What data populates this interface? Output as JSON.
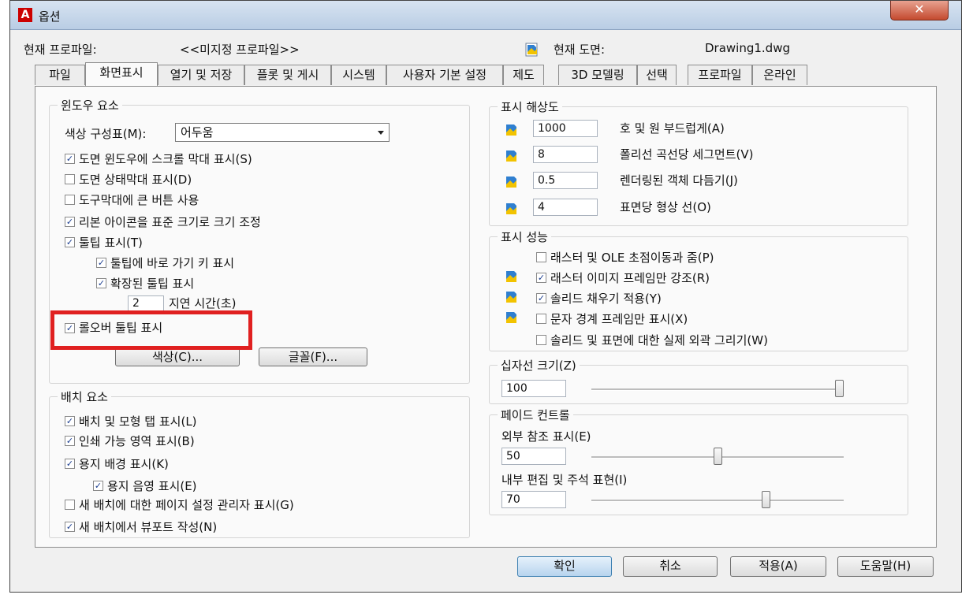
{
  "window": {
    "title": "옵션",
    "app_icon": "A",
    "close_glyph": "✕"
  },
  "header": {
    "profile_label": "현재 프로파일:",
    "profile_value": "<<미지정 프로파일>>",
    "drawing_label": "현재 도면:",
    "drawing_value": "Drawing1.dwg"
  },
  "tabs": [
    "파일",
    "화면표시",
    "열기 및 저장",
    "플롯 및 게시",
    "시스템",
    "사용자 기본 설정",
    "제도",
    "3D 모델링",
    "선택",
    "프로파일",
    "온라인"
  ],
  "active_tab": "화면표시",
  "window_elements": {
    "title": "윈도우 요소",
    "color_scheme_label": "색상 구성표(M):",
    "color_scheme_value": "어두움",
    "checkboxes": [
      {
        "label": "도면 윈도우에 스크롤 막대 표시(S)",
        "checked": true
      },
      {
        "label": "도면 상태막대 표시(D)",
        "checked": false
      },
      {
        "label": "도구막대에 큰 버튼 사용",
        "checked": false
      },
      {
        "label": "리본 아이콘을 표준 크기로 크기 조정",
        "checked": true
      },
      {
        "label": "툴팁 표시(T)",
        "checked": true
      },
      {
        "label": "툴팁에 바로 가기 키 표시",
        "checked": true
      },
      {
        "label": "확장된 툴팁 표시",
        "checked": true
      }
    ],
    "delay_value": "2",
    "delay_label": "지연 시간(초)",
    "rollover_label": "롤오버 툴팁 표시",
    "rollover_checked": true,
    "colors_button": "색상(C)...",
    "fonts_button": "글꼴(F)..."
  },
  "layout_elements": {
    "title": "배치 요소",
    "checkboxes": [
      {
        "label": "배치 및 모형 탭 표시(L)",
        "checked": true
      },
      {
        "label": "인쇄 가능 영역 표시(B)",
        "checked": true
      },
      {
        "label": "용지 배경 표시(K)",
        "checked": true
      },
      {
        "label": "용지 음영 표시(E)",
        "checked": true
      },
      {
        "label": "새 배치에 대한 페이지 설정 관리자 표시(G)",
        "checked": false
      },
      {
        "label": "새 배치에서 뷰포트 작성(N)",
        "checked": true
      }
    ]
  },
  "display_resolution": {
    "title": "표시 해상도",
    "items": [
      {
        "value": "1000",
        "label": "호 및 원 부드럽게(A)"
      },
      {
        "value": "8",
        "label": "폴리선 곡선당 세그먼트(V)"
      },
      {
        "value": "0.5",
        "label": "렌더링된 객체 다듬기(J)"
      },
      {
        "value": "4",
        "label": "표면당 형상 선(O)"
      }
    ]
  },
  "display_performance": {
    "title": "표시 성능",
    "checkboxes": [
      {
        "label": "래스터 및 OLE 초점이동과 줌(P)",
        "checked": false
      },
      {
        "label": "래스터 이미지 프레임만 강조(R)",
        "checked": true
      },
      {
        "label": "솔리드 채우기 적용(Y)",
        "checked": true
      },
      {
        "label": "문자 경계 프레임만 표시(X)",
        "checked": false
      },
      {
        "label": "솔리드 및 표면에 대한 실제 외곽 그리기(W)",
        "checked": false
      }
    ]
  },
  "crosshair": {
    "title": "십자선 크기(Z)",
    "value": "100",
    "level_percent": 100
  },
  "fade_control": {
    "title": "페이드 컨트롤",
    "xref_label": "외부 참조 표시(E)",
    "xref_value": "50",
    "xref_level_percent": 50,
    "inplace_label": "내부 편집 및 주석 표현(I)",
    "inplace_value": "70",
    "inplace_level_percent": 70
  },
  "buttons": {
    "ok": "확인",
    "cancel": "취소",
    "apply": "적용(A)",
    "help": "도움말(H)"
  },
  "colors": {
    "highlight_box": "#e02020",
    "close_button": "#c44a2f"
  }
}
